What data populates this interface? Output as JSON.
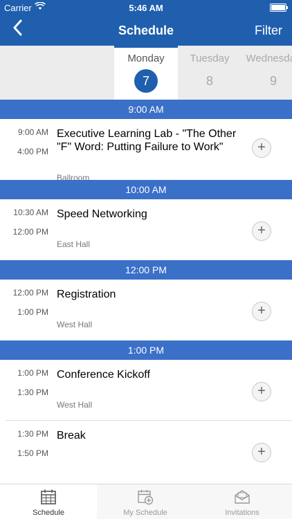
{
  "status_bar": {
    "carrier": "Carrier",
    "time": "5:46 AM"
  },
  "nav": {
    "title": "Schedule",
    "filter_label": "Filter"
  },
  "days": [
    {
      "name": "Monday",
      "number": "7",
      "selected": true
    },
    {
      "name": "Tuesday",
      "number": "8",
      "selected": false
    },
    {
      "name": "Wednesday",
      "number": "9",
      "selected": false
    }
  ],
  "groups": [
    {
      "time": "9:00 AM",
      "items": [
        {
          "start": "9:00 AM",
          "end": "4:00 PM",
          "title": "Executive Learning Lab - \"The Other \"F\" Word: Putting Failure to Work\"",
          "location": "Ballroom"
        }
      ]
    },
    {
      "time": "10:00 AM",
      "items": [
        {
          "start": "10:30 AM",
          "end": "12:00 PM",
          "title": "Speed Networking",
          "location": "East Hall"
        }
      ]
    },
    {
      "time": "12:00 PM",
      "items": [
        {
          "start": "12:00 PM",
          "end": "1:00 PM",
          "title": "Registration",
          "location": "West Hall"
        }
      ]
    },
    {
      "time": "1:00 PM",
      "items": [
        {
          "start": "1:00 PM",
          "end": "1:30 PM",
          "title": "Conference Kickoff",
          "location": "West Hall"
        },
        {
          "start": "1:30 PM",
          "end": "1:50 PM",
          "title": "Break",
          "location": ""
        }
      ]
    }
  ],
  "tabs": [
    {
      "label": "Schedule",
      "icon": "calendar-icon",
      "active": true
    },
    {
      "label": "My Schedule",
      "icon": "calendar-add-icon",
      "active": false
    },
    {
      "label": "Invitations",
      "icon": "envelope-icon",
      "active": false
    }
  ],
  "colors": {
    "primary": "#1f5fae",
    "band": "#3b70c8"
  }
}
